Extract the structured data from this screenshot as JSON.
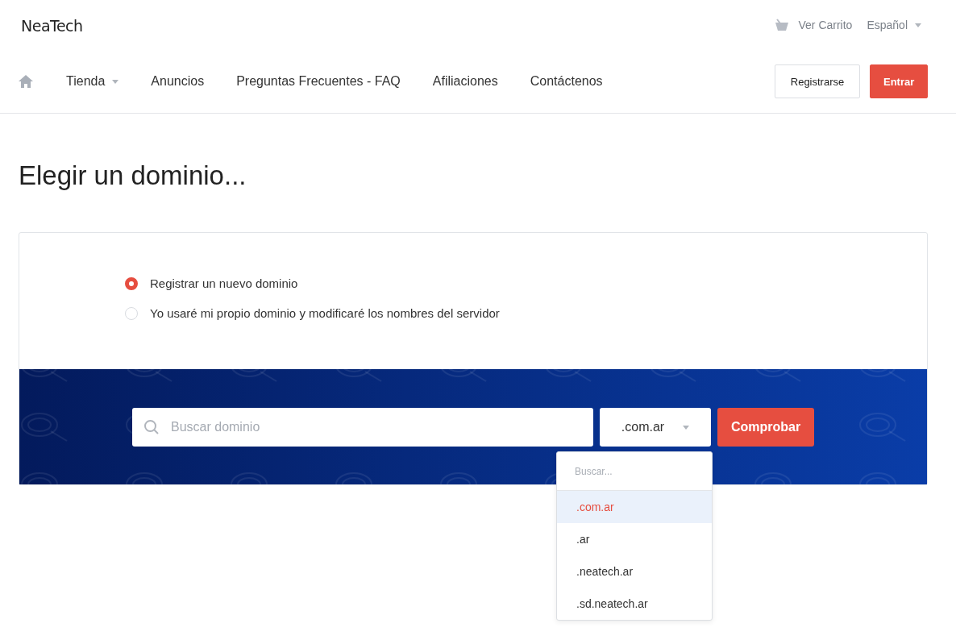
{
  "logo": {
    "text": "NeaTech"
  },
  "topbar": {
    "cart": "Ver Carrito",
    "language": "Español"
  },
  "nav": {
    "items": [
      {
        "label": "Tienda",
        "dropdown": true
      },
      {
        "label": "Anuncios",
        "dropdown": false
      },
      {
        "label": "Preguntas Frecuentes - FAQ",
        "dropdown": false
      },
      {
        "label": "Afiliaciones",
        "dropdown": false
      },
      {
        "label": "Contáctenos",
        "dropdown": false
      }
    ],
    "buttons": [
      {
        "label": "Registrarse",
        "kind": "outline"
      },
      {
        "label": "Entrar",
        "kind": "primary"
      }
    ]
  },
  "heading": "Elegir un dominio...",
  "options": [
    {
      "label": "Registrar un nuevo dominio",
      "selected": true
    },
    {
      "label": "Yo usaré mi propio dominio y modificaré los nombres del servidor",
      "selected": false
    }
  ],
  "search": {
    "placeholder": "Buscar dominio",
    "tld": ".com.ar",
    "button": "Comprobar"
  },
  "dropdown": {
    "placeholder": "Buscar...",
    "items": [
      {
        "label": ".com.ar",
        "selected": true
      },
      {
        "label": ".ar",
        "selected": false
      },
      {
        "label": ".neatech.ar",
        "selected": false
      },
      {
        "label": ".sd.neatech.ar",
        "selected": false
      }
    ]
  }
}
